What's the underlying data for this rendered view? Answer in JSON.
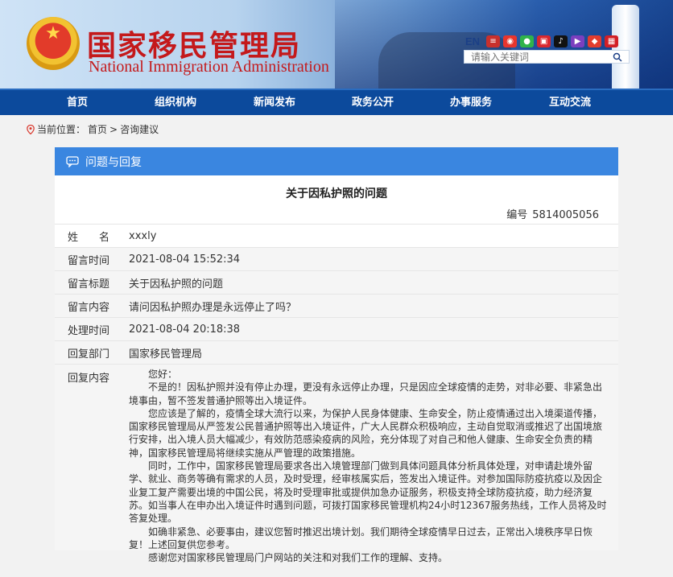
{
  "header": {
    "site_name_zh": "国家移民管理局",
    "site_name_en": "National Immigration Administration",
    "lang_switch": "EN",
    "search_placeholder": "请输入关键词"
  },
  "nav": {
    "items": [
      {
        "label": "首页"
      },
      {
        "label": "组织机构"
      },
      {
        "label": "新闻发布"
      },
      {
        "label": "政务公开"
      },
      {
        "label": "办事服务"
      },
      {
        "label": "互动交流"
      }
    ]
  },
  "breadcrumb": {
    "prefix": "当前位置：",
    "home": "首页",
    "separator": ">",
    "current": "咨询建议"
  },
  "card": {
    "header": "问题与回复",
    "title": "关于因私护照的问题",
    "serial_label": "编号",
    "serial_value": "5814005056",
    "rows": [
      {
        "label": "姓　　名",
        "value": "xxxly"
      },
      {
        "label": "留言时间",
        "value": "2021-08-04 15:52:34"
      },
      {
        "label": "留言标题",
        "value": "关于因私护照的问题"
      },
      {
        "label": "留言内容",
        "value": "请问因私护照办理是永远停止了吗？"
      },
      {
        "label": "处理时间",
        "value": "2021-08-04 20:18:38"
      },
      {
        "label": "回复部门",
        "value": "国家移民管理局"
      }
    ],
    "reply_label": "回复内容",
    "reply_paragraphs": [
      "您好：",
      "不是的！因私护照并没有停止办理，更没有永远停止办理，只是因应全球疫情的走势，对非必要、非紧急出境事由，暂不签发普通护照等出入境证件。",
      "您应该是了解的，疫情全球大流行以来，为保护人民身体健康、生命安全，防止疫情通过出入境渠道传播，国家移民管理局从严签发公民普通护照等出入境证件，广大人民群众积极响应，主动自觉取消或推迟了出国境旅行安排，出入境人员大幅减少，有效防范感染疫病的风险，充分体现了对自己和他人健康、生命安全负责的精神，国家移民管理局将继续实施从严管理的政策措施。",
      "同时，工作中，国家移民管理局要求各出入境管理部门做到具体问题具体分析具体处理，对申请赴境外留学、就业、商务等确有需求的人员，及时受理，经审核属实后，签发出入境证件。对参加国际防疫抗疫以及因企业复工复产需要出境的中国公民，将及时受理审批或提供加急办证服务，积极支持全球防疫抗疫，助力经济复苏。如当事人在申办出入境证件时遇到问题，可拨打国家移民管理机构24小时12367服务热线，工作人员将及时答复处理。",
      "如确非紧急、必要事由，建议您暂时推迟出境计划。我们期待全球疫情早日过去，正常出入境秩序早日恢复！上述回复供您参考。",
      "感谢您对国家移民管理局门户网站的关注和对我们工作的理解、支持。"
    ]
  },
  "colors": {
    "nav_bg": "#0c4a9c",
    "card_header_bg": "#3a86e0",
    "logo_red": "#c4191b"
  }
}
